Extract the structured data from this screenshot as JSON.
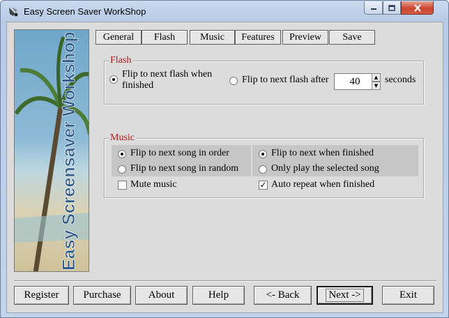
{
  "window": {
    "title": "Easy Screen Saver WorkShop"
  },
  "banner": {
    "text": "Easy Screensaver Workshop"
  },
  "tabs": [
    {
      "label": "General"
    },
    {
      "label": "Flash"
    },
    {
      "label": "Music"
    },
    {
      "label": "Features"
    },
    {
      "label": "Preview"
    },
    {
      "label": "Save"
    }
  ],
  "flash": {
    "title": "Flash",
    "option_finished": "Flip to next flash when finished",
    "option_after": "Flip to next flash after",
    "seconds_value": "40",
    "seconds_label": "seconds"
  },
  "music": {
    "title": "Music",
    "order": "Flip to next song in order",
    "random": "Flip to next song in random",
    "next_when_finished": "Flip to next when finished",
    "only_selected": "Only play the selected song",
    "mute": "Mute music",
    "auto_repeat": "Auto repeat when finished"
  },
  "buttons": {
    "register": "Register",
    "purchase": "Purchase",
    "about": "About",
    "help": "Help",
    "back": "<- Back",
    "next": "Next ->",
    "exit": "Exit"
  }
}
